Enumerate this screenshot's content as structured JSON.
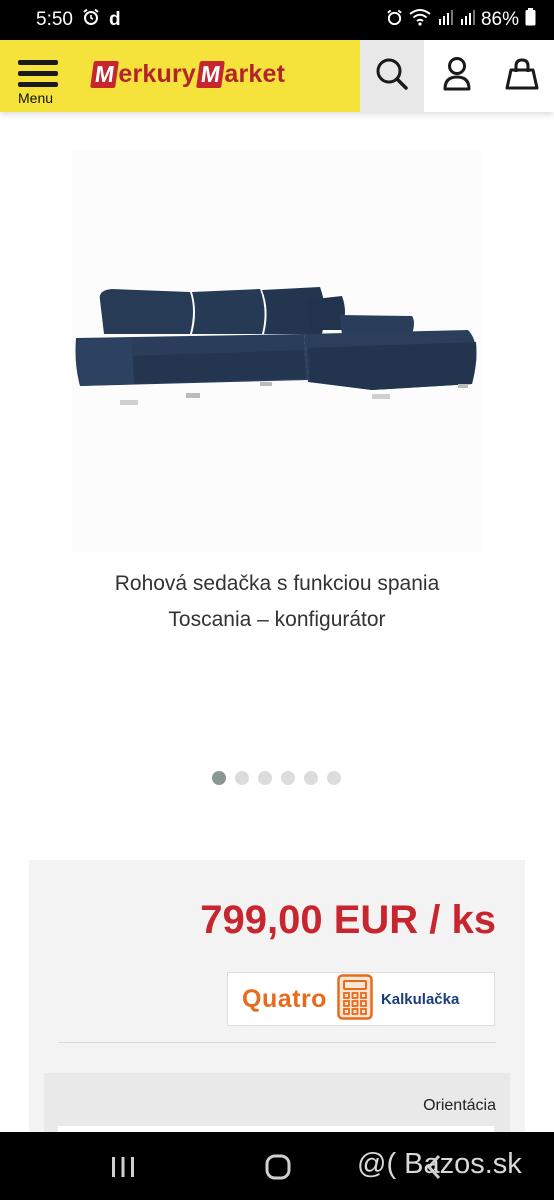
{
  "status_bar": {
    "time": "5:50",
    "app_glyph": "d",
    "battery": "86%",
    "icons": [
      "alarm-icon",
      "wifi-icon",
      "signal-icon",
      "battery-icon"
    ]
  },
  "header": {
    "menu_label": "Menu",
    "logo_part1_letter": "M",
    "logo_part1_rest": "erkury",
    "logo_part2_letter": "M",
    "logo_part2_rest": "arket",
    "icons": [
      "menu-icon",
      "search-icon",
      "user-icon",
      "cart-icon"
    ],
    "brand_color": "#f5e23a",
    "accent_color": "#c8262f"
  },
  "product": {
    "title_line1": "Rohová sedačka s funkciou spania",
    "title_line2": "Toscania – konfigurátor",
    "carousel": {
      "total": 6,
      "active": 1
    }
  },
  "pricing": {
    "price": "799,00 EUR / ks",
    "quatro_logo": "Quatro",
    "quatro_label": "Kalkulačka",
    "orientation_label": "Orientácia"
  },
  "watermark": "@( Bazos.sk"
}
